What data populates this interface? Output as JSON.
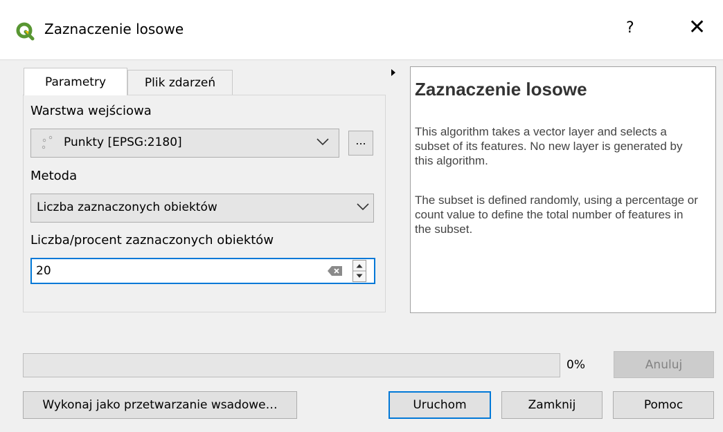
{
  "window": {
    "title": "Zaznaczenie losowe",
    "help_button": "?",
    "close_button": "✕"
  },
  "tabs": [
    {
      "label": "Parametry",
      "active": true
    },
    {
      "label": "Plik zdarzeń",
      "active": false
    }
  ],
  "params": {
    "input_layer_label": "Warstwa wejściowa",
    "input_layer_value": "Punkty [EPSG:2180]",
    "browse_label": "...",
    "method_label": "Metoda",
    "method_value": "Liczba zaznaczonych obiektów",
    "count_label": "Liczba/procent zaznaczonych obiektów",
    "count_value": "20"
  },
  "help": {
    "title": "Zaznaczenie losowe",
    "paragraph1": "This algorithm takes a vector layer and selects a subset of its features. No new layer is generated by this algorithm.",
    "paragraph2": "The subset is defined randomly, using a percentage or count value to define the total number of features in the subset."
  },
  "progress": {
    "percent_text": "0%",
    "value": 0,
    "cancel_label": "Anuluj"
  },
  "buttons": {
    "batch": "Wykonaj jako przetwarzanie wsadowe…",
    "run": "Uruchom",
    "close": "Zamknij",
    "help": "Pomoc"
  },
  "colors": {
    "accent": "#0078d7",
    "qgis_green": "#589632",
    "qgis_yellow": "#f0c00b"
  },
  "icons": {
    "app": "qgis-logo-icon",
    "layer": "point-layer-icon",
    "clear": "clear-text-icon",
    "dropdown": "chevron-down-icon",
    "expand": "triangle-right-icon"
  }
}
